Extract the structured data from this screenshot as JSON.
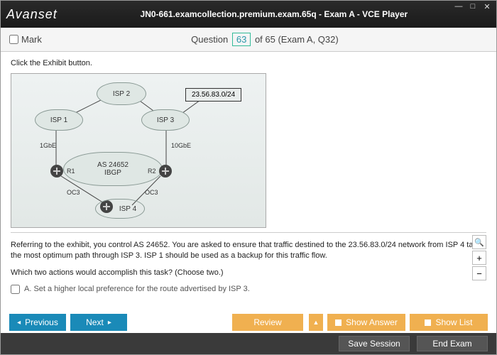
{
  "title_bar": {
    "logo": "Avanset",
    "app_title": "JN0-661.examcollection.premium.exam.65q - Exam A - VCE Player"
  },
  "qbar": {
    "mark_label": "Mark",
    "question_word": "Question",
    "current": "63",
    "total_suffix": " of 65 (Exam A, Q32)"
  },
  "content": {
    "instruction": "Click the Exhibit button.",
    "exhibit": {
      "isp1": "ISP 1",
      "isp2": "ISP 2",
      "isp3": "ISP 3",
      "isp4": "ISP 4",
      "prefix": "23.56.83.0/24",
      "as_line1": "AS 24652",
      "as_line2": "IBGP",
      "r1": "R1",
      "r2": "R2",
      "oc3a": "OC3",
      "oc3b": "OC3",
      "l1g": "1GbE",
      "l10g": "10GbE"
    },
    "paragraph1": "Referring to the exhibit, you control AS 24652. You are asked to ensure that traffic destined to the 23.56.83.0/24 network from ISP 4 takes the most optimum path through ISP 3. ISP 1 should be used as a backup for this traffic flow.",
    "paragraph2": "Which two actions would accomplish this task? (Choose two.)",
    "optA": "A.  Set a higher local preference for the route advertised by ISP 3."
  },
  "nav": {
    "previous": "Previous",
    "next": "Next",
    "review": "Review",
    "show_answer": "Show Answer",
    "show_list": "Show List"
  },
  "footer": {
    "save": "Save Session",
    "end": "End Exam"
  }
}
